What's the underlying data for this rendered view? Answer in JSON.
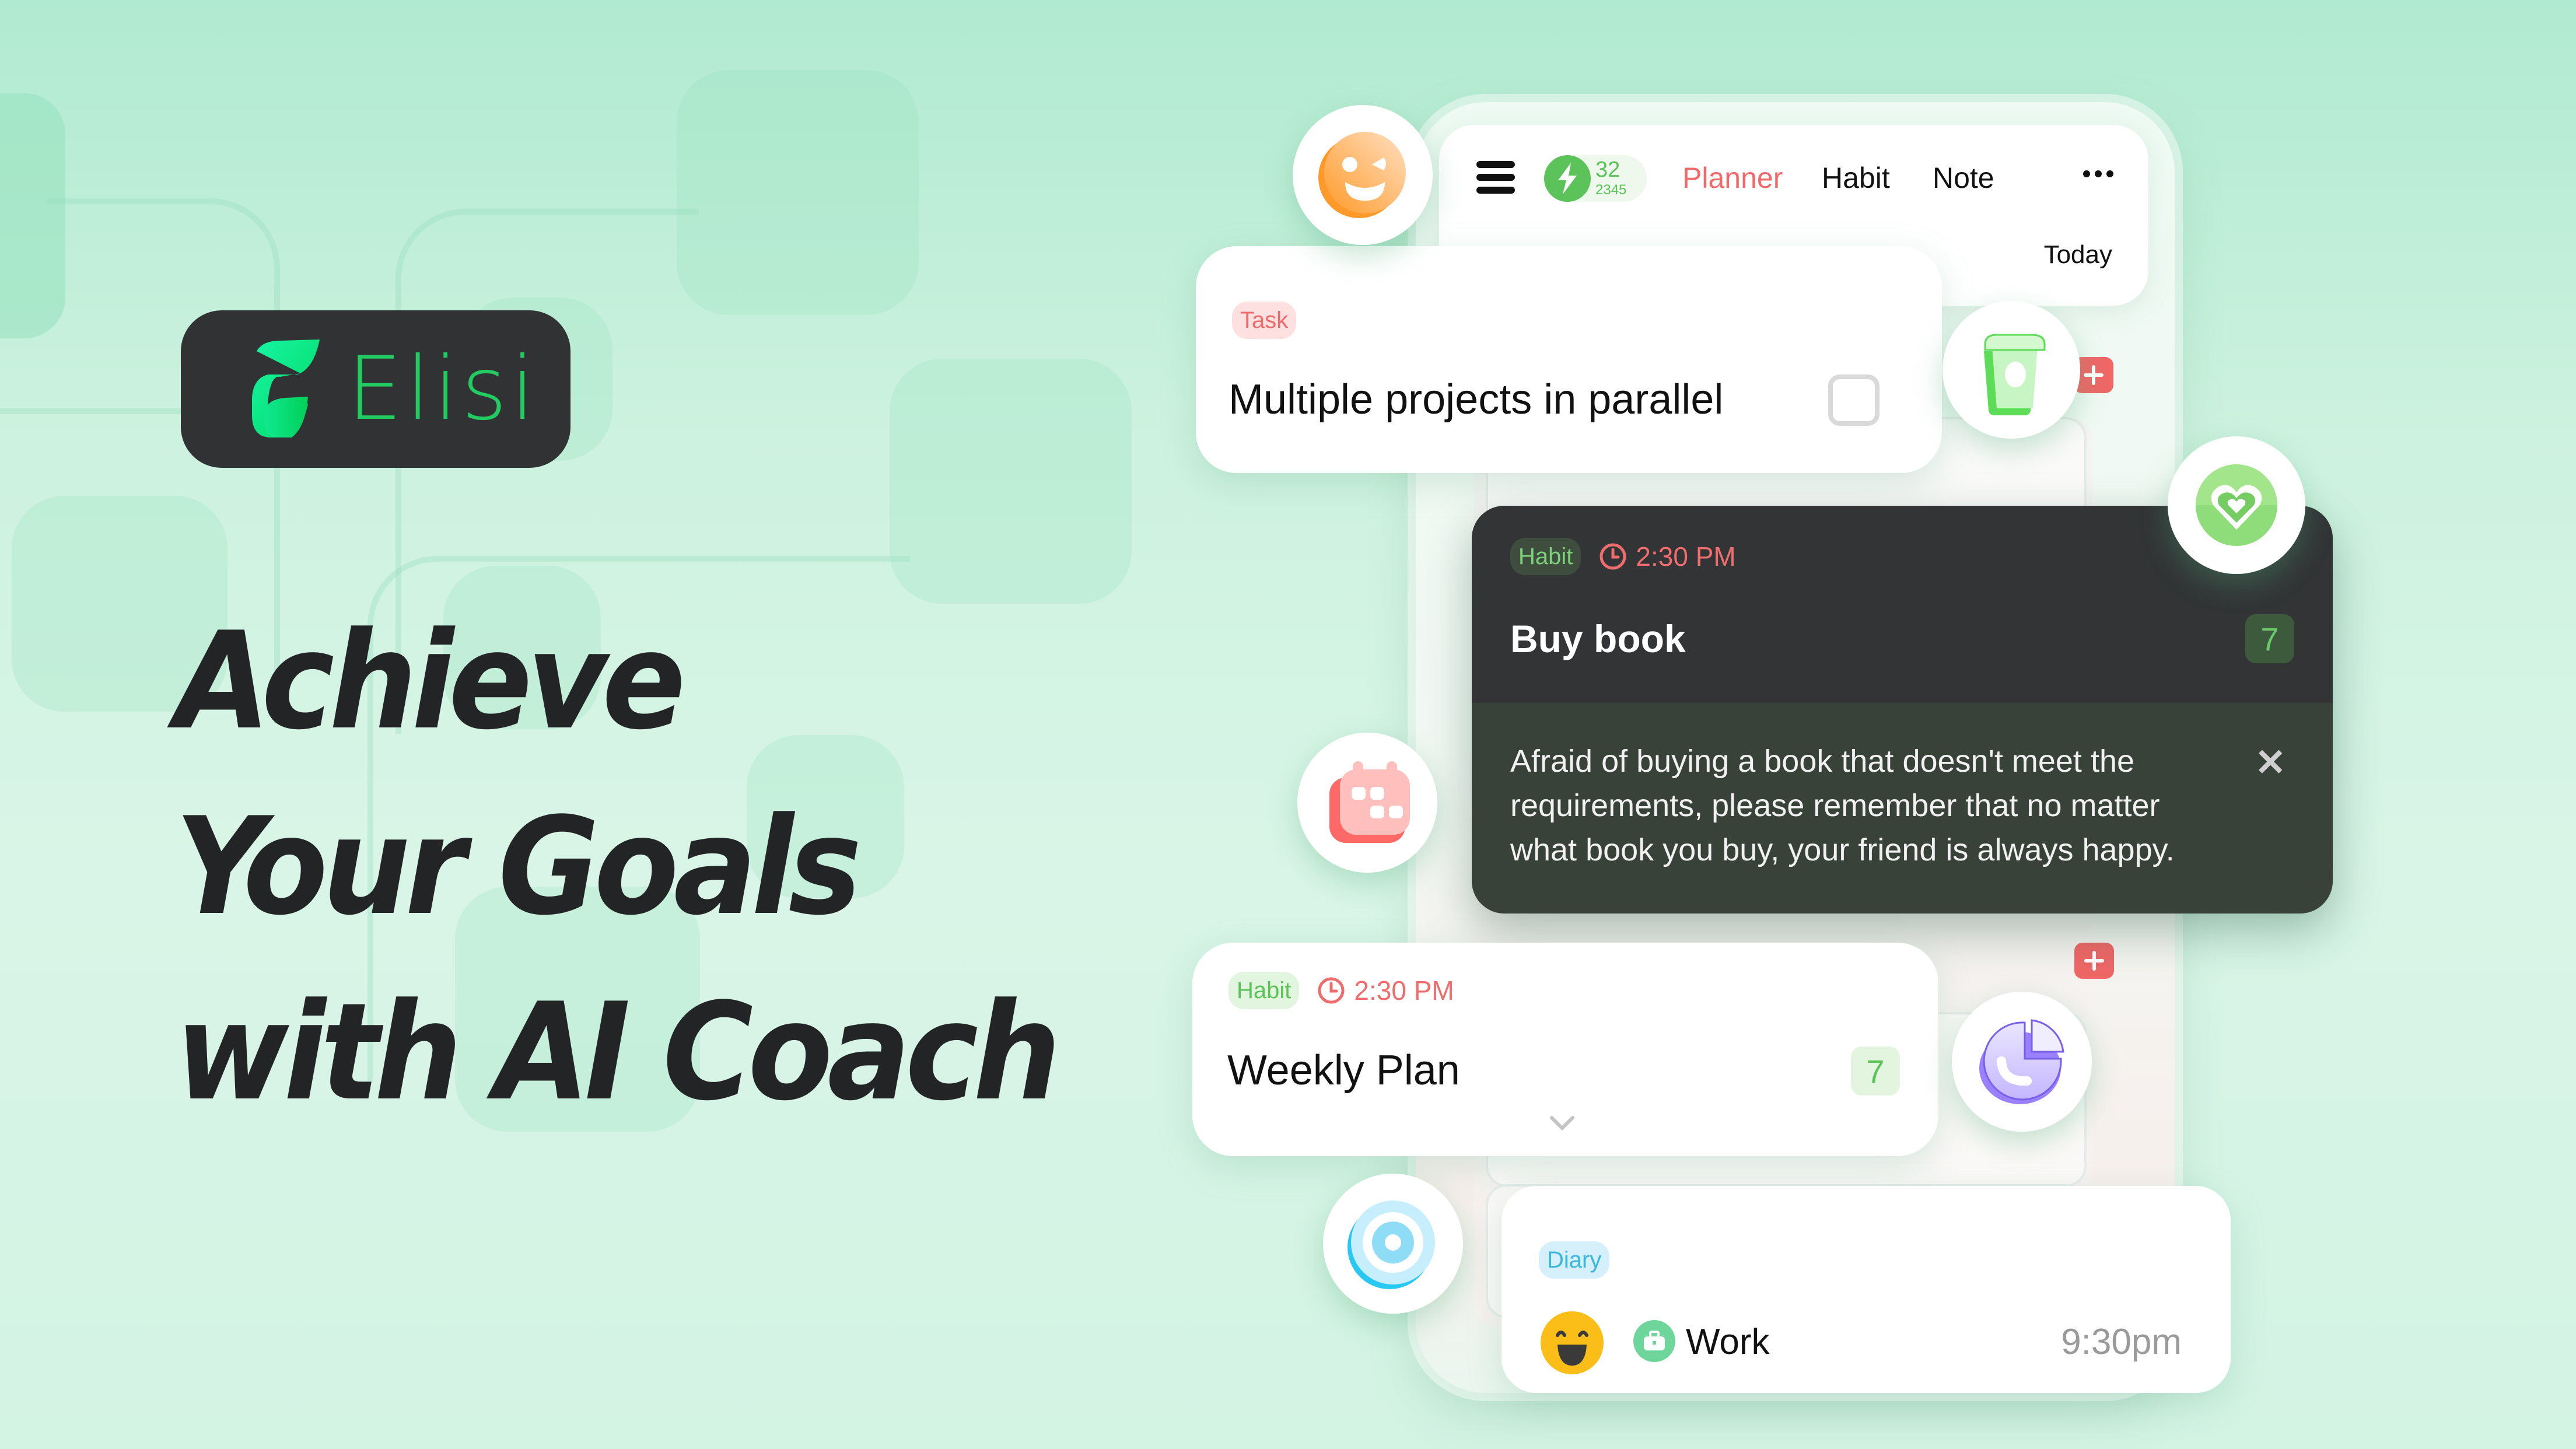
{
  "brand": {
    "name": "Elisi",
    "accent": "#22cc60",
    "pill_bg": "#303234"
  },
  "headline": {
    "lines": [
      "Achieve",
      "Your Goals",
      "with AI Coach"
    ]
  },
  "app": {
    "header": {
      "energy_value": "32",
      "energy_total": "2345",
      "tabs": [
        {
          "label": "Planner",
          "active": true
        },
        {
          "label": "Habit",
          "active": false
        },
        {
          "label": "Note",
          "active": false
        }
      ],
      "more_label": "more-options",
      "date_label": "Today"
    },
    "task_card": {
      "tag": "Task",
      "title": "Multiple projects in parallel",
      "checked": false
    },
    "habit_card": {
      "tag": "Habit",
      "time": "2:30 PM",
      "title": "Buy book",
      "count": "7",
      "ai_message": "Afraid of buying a book that doesn't meet the requirements, please remember that no matter what book you buy, your friend is always happy."
    },
    "weekly_card": {
      "tag": "Habit",
      "time": "2:30 PM",
      "title": "Weekly Plan",
      "count": "7"
    },
    "diary_card": {
      "tag": "Diary",
      "mood": "laughing-face",
      "category": "Work",
      "time": "9:30pm"
    }
  },
  "floating_icons": [
    "smile-wink-icon",
    "cup-icon",
    "heart-badge-icon",
    "calendar-icon",
    "pie-chart-icon",
    "target-icon"
  ],
  "colors": {
    "red": "#ef6767",
    "green": "#5cc25a",
    "blue": "#39b6dc",
    "purple": "#9c86f6",
    "orange": "#ffa242"
  }
}
